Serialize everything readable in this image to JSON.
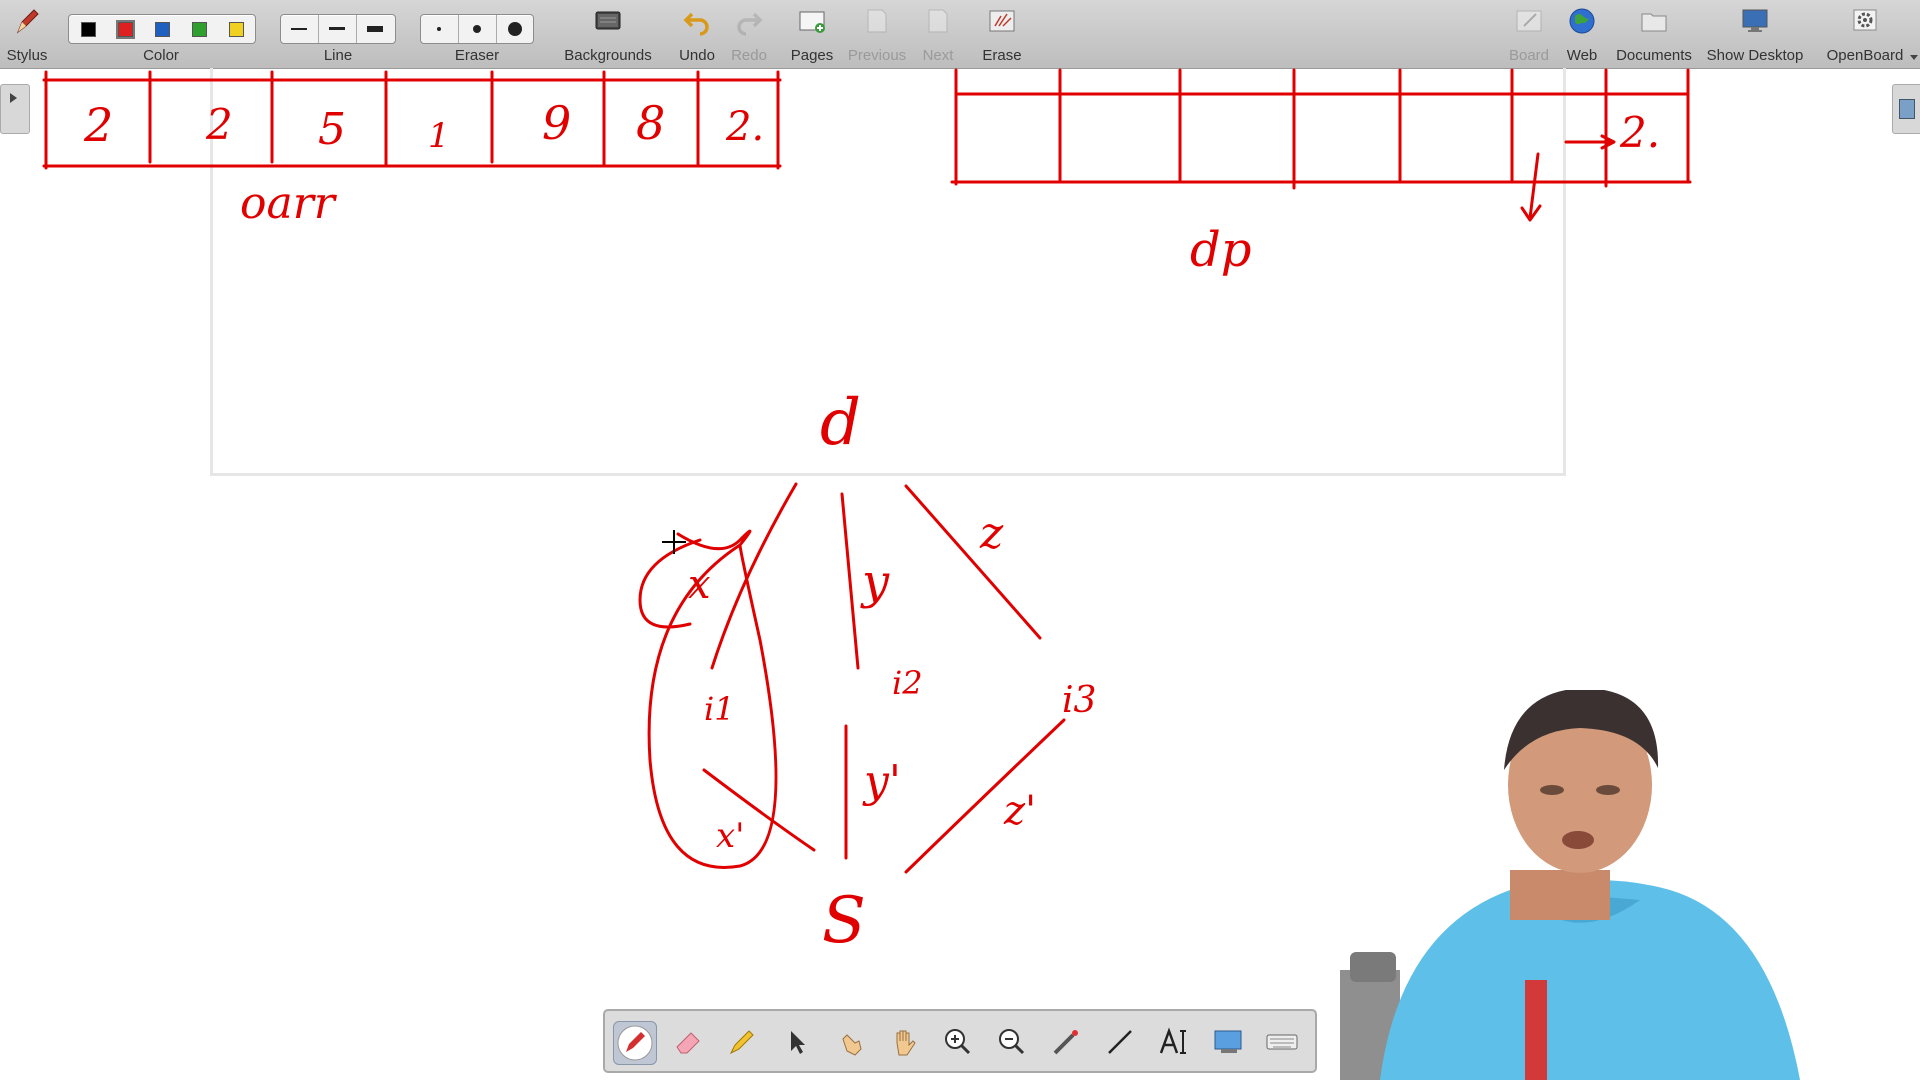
{
  "toolbar": {
    "stylus_label": "Stylus",
    "color_label": "Color",
    "line_label": "Line",
    "eraser_label": "Eraser",
    "backgrounds_label": "Backgrounds",
    "undo_label": "Undo",
    "redo_label": "Redo",
    "pages_label": "Pages",
    "previous_label": "Previous",
    "next_label": "Next",
    "erase_label": "Erase",
    "board_label": "Board",
    "web_label": "Web",
    "documents_label": "Documents",
    "show_desktop_label": "Show Desktop",
    "openboard_label": "OpenBoard",
    "colors": [
      "#000000",
      "#e02020",
      "#1f5fbf",
      "#2ea02e",
      "#f0d020"
    ],
    "selected_color": "#e02020"
  },
  "board": {
    "ink_color": "#e00000",
    "arr_label": "oarr",
    "arr_values": [
      "2",
      "2",
      "5",
      "1",
      "9",
      "8",
      "2."
    ],
    "dp_label": "dp",
    "dp_last_value": "2.",
    "graph": {
      "top_node": "d",
      "bottom_node": "S",
      "edge_labels_top": [
        "x",
        "y",
        "z"
      ],
      "edge_indices": [
        "i1",
        "i2",
        "i3"
      ],
      "edge_labels_bottom": [
        "x'",
        "y'",
        "z'"
      ]
    }
  },
  "bottom_toolbar": {
    "tools": [
      "pen-tool",
      "eraser-tool",
      "highlighter-tool",
      "selector-tool",
      "interact-tool",
      "hand-tool",
      "zoom-in-tool",
      "zoom-out-tool",
      "laser-pointer-tool",
      "line-tool",
      "text-tool",
      "capture-tool",
      "keyboard-tool"
    ],
    "active_tool": "pen-tool"
  }
}
